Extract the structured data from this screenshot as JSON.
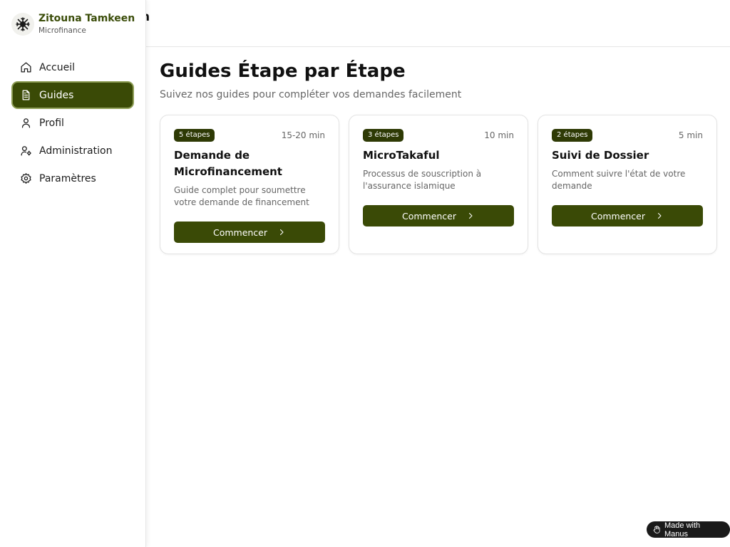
{
  "header": {
    "title_fragment": "n"
  },
  "brand": {
    "name": "Zitouna Tamkeen",
    "subtitle": "Microfinance",
    "logo_icon": "tree-icon"
  },
  "sidebar": {
    "items": [
      {
        "label": "Accueil",
        "icon": "home-icon",
        "active": false
      },
      {
        "label": "Guides",
        "icon": "document-icon",
        "active": true
      },
      {
        "label": "Profil",
        "icon": "user-icon",
        "active": false
      },
      {
        "label": "Administration",
        "icon": "user-cog-icon",
        "active": false
      },
      {
        "label": "Paramètres",
        "icon": "gear-icon",
        "active": false
      }
    ]
  },
  "main": {
    "title": "Guides Étape par Étape",
    "subtitle": "Suivez nos guides pour compléter vos demandes facilement",
    "cards": [
      {
        "badge": "5 étapes",
        "duration": "15-20 min",
        "title": "Demande de Microfinancement",
        "description": "Guide complet pour soumettre votre demande de financement",
        "button": "Commencer"
      },
      {
        "badge": "3 étapes",
        "duration": "10 min",
        "title": "MicroTakaful",
        "description": "Processus de souscription à l'assurance islamique",
        "button": "Commencer"
      },
      {
        "badge": "2 étapes",
        "duration": "5 min",
        "title": "Suivi de Dossier",
        "description": "Comment suivre l'état de votre demande",
        "button": "Commencer"
      }
    ]
  },
  "footer_badge": {
    "label": "Made with Manus"
  },
  "colors": {
    "primary": "#3a4a06",
    "brand_text": "#3b4d0a",
    "badge_bg": "#2e3a05",
    "active_ring": "#8d9d55"
  }
}
